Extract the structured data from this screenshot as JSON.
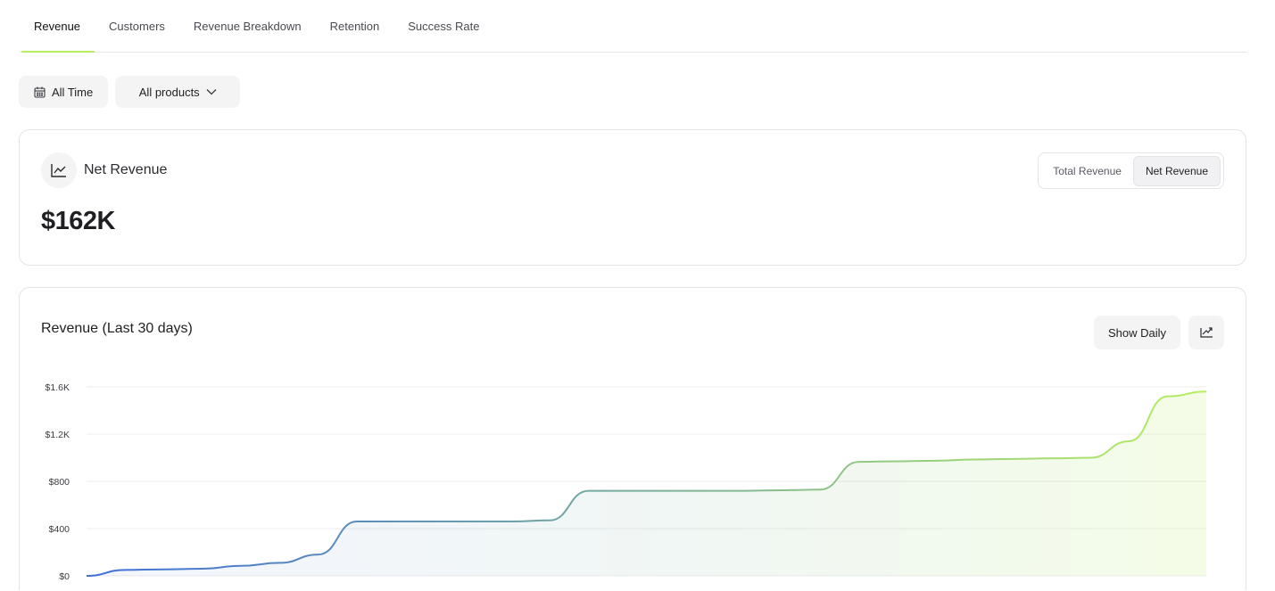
{
  "tabs": [
    {
      "label": "Revenue",
      "active": true
    },
    {
      "label": "Customers",
      "active": false
    },
    {
      "label": "Revenue Breakdown",
      "active": false
    },
    {
      "label": "Retention",
      "active": false
    },
    {
      "label": "Success Rate",
      "active": false
    }
  ],
  "filters": {
    "date_label": "All Time",
    "date_icon": "calendar-icon",
    "product_label": "All products",
    "product_icon": "chevron-down-icon"
  },
  "metric_card": {
    "icon": "line-chart-icon",
    "title": "Net Revenue",
    "value": "$162K",
    "toggle": [
      {
        "label": "Total Revenue",
        "active": false
      },
      {
        "label": "Net Revenue",
        "active": true
      }
    ]
  },
  "chart_card": {
    "title": "Revenue (Last 30 days)",
    "show_daily_label": "Show Daily",
    "share_icon": "share-chart-icon"
  },
  "colors": {
    "accent": "#b6ef5f",
    "line_start": "#3f6fd8",
    "line_end": "#b6ef5f"
  },
  "chart_data": {
    "type": "area",
    "title": "Revenue (Last 30 days)",
    "y_ticks": [
      "$1.6K",
      "$1.2K",
      "$800",
      "$400",
      "$0"
    ],
    "ylim": [
      0,
      1600
    ],
    "grid": true,
    "x": [
      0,
      1,
      2,
      3,
      4,
      5,
      6,
      7,
      8,
      9,
      10,
      11,
      12,
      13,
      14,
      15,
      16,
      17,
      18,
      19,
      20,
      21,
      22,
      23,
      24,
      25,
      26,
      27,
      28,
      29
    ],
    "values": [
      0,
      50,
      55,
      60,
      85,
      110,
      180,
      460,
      460,
      460,
      460,
      460,
      470,
      720,
      720,
      720,
      720,
      720,
      725,
      730,
      965,
      970,
      975,
      985,
      990,
      995,
      1000,
      1140,
      1520,
      1560
    ]
  }
}
